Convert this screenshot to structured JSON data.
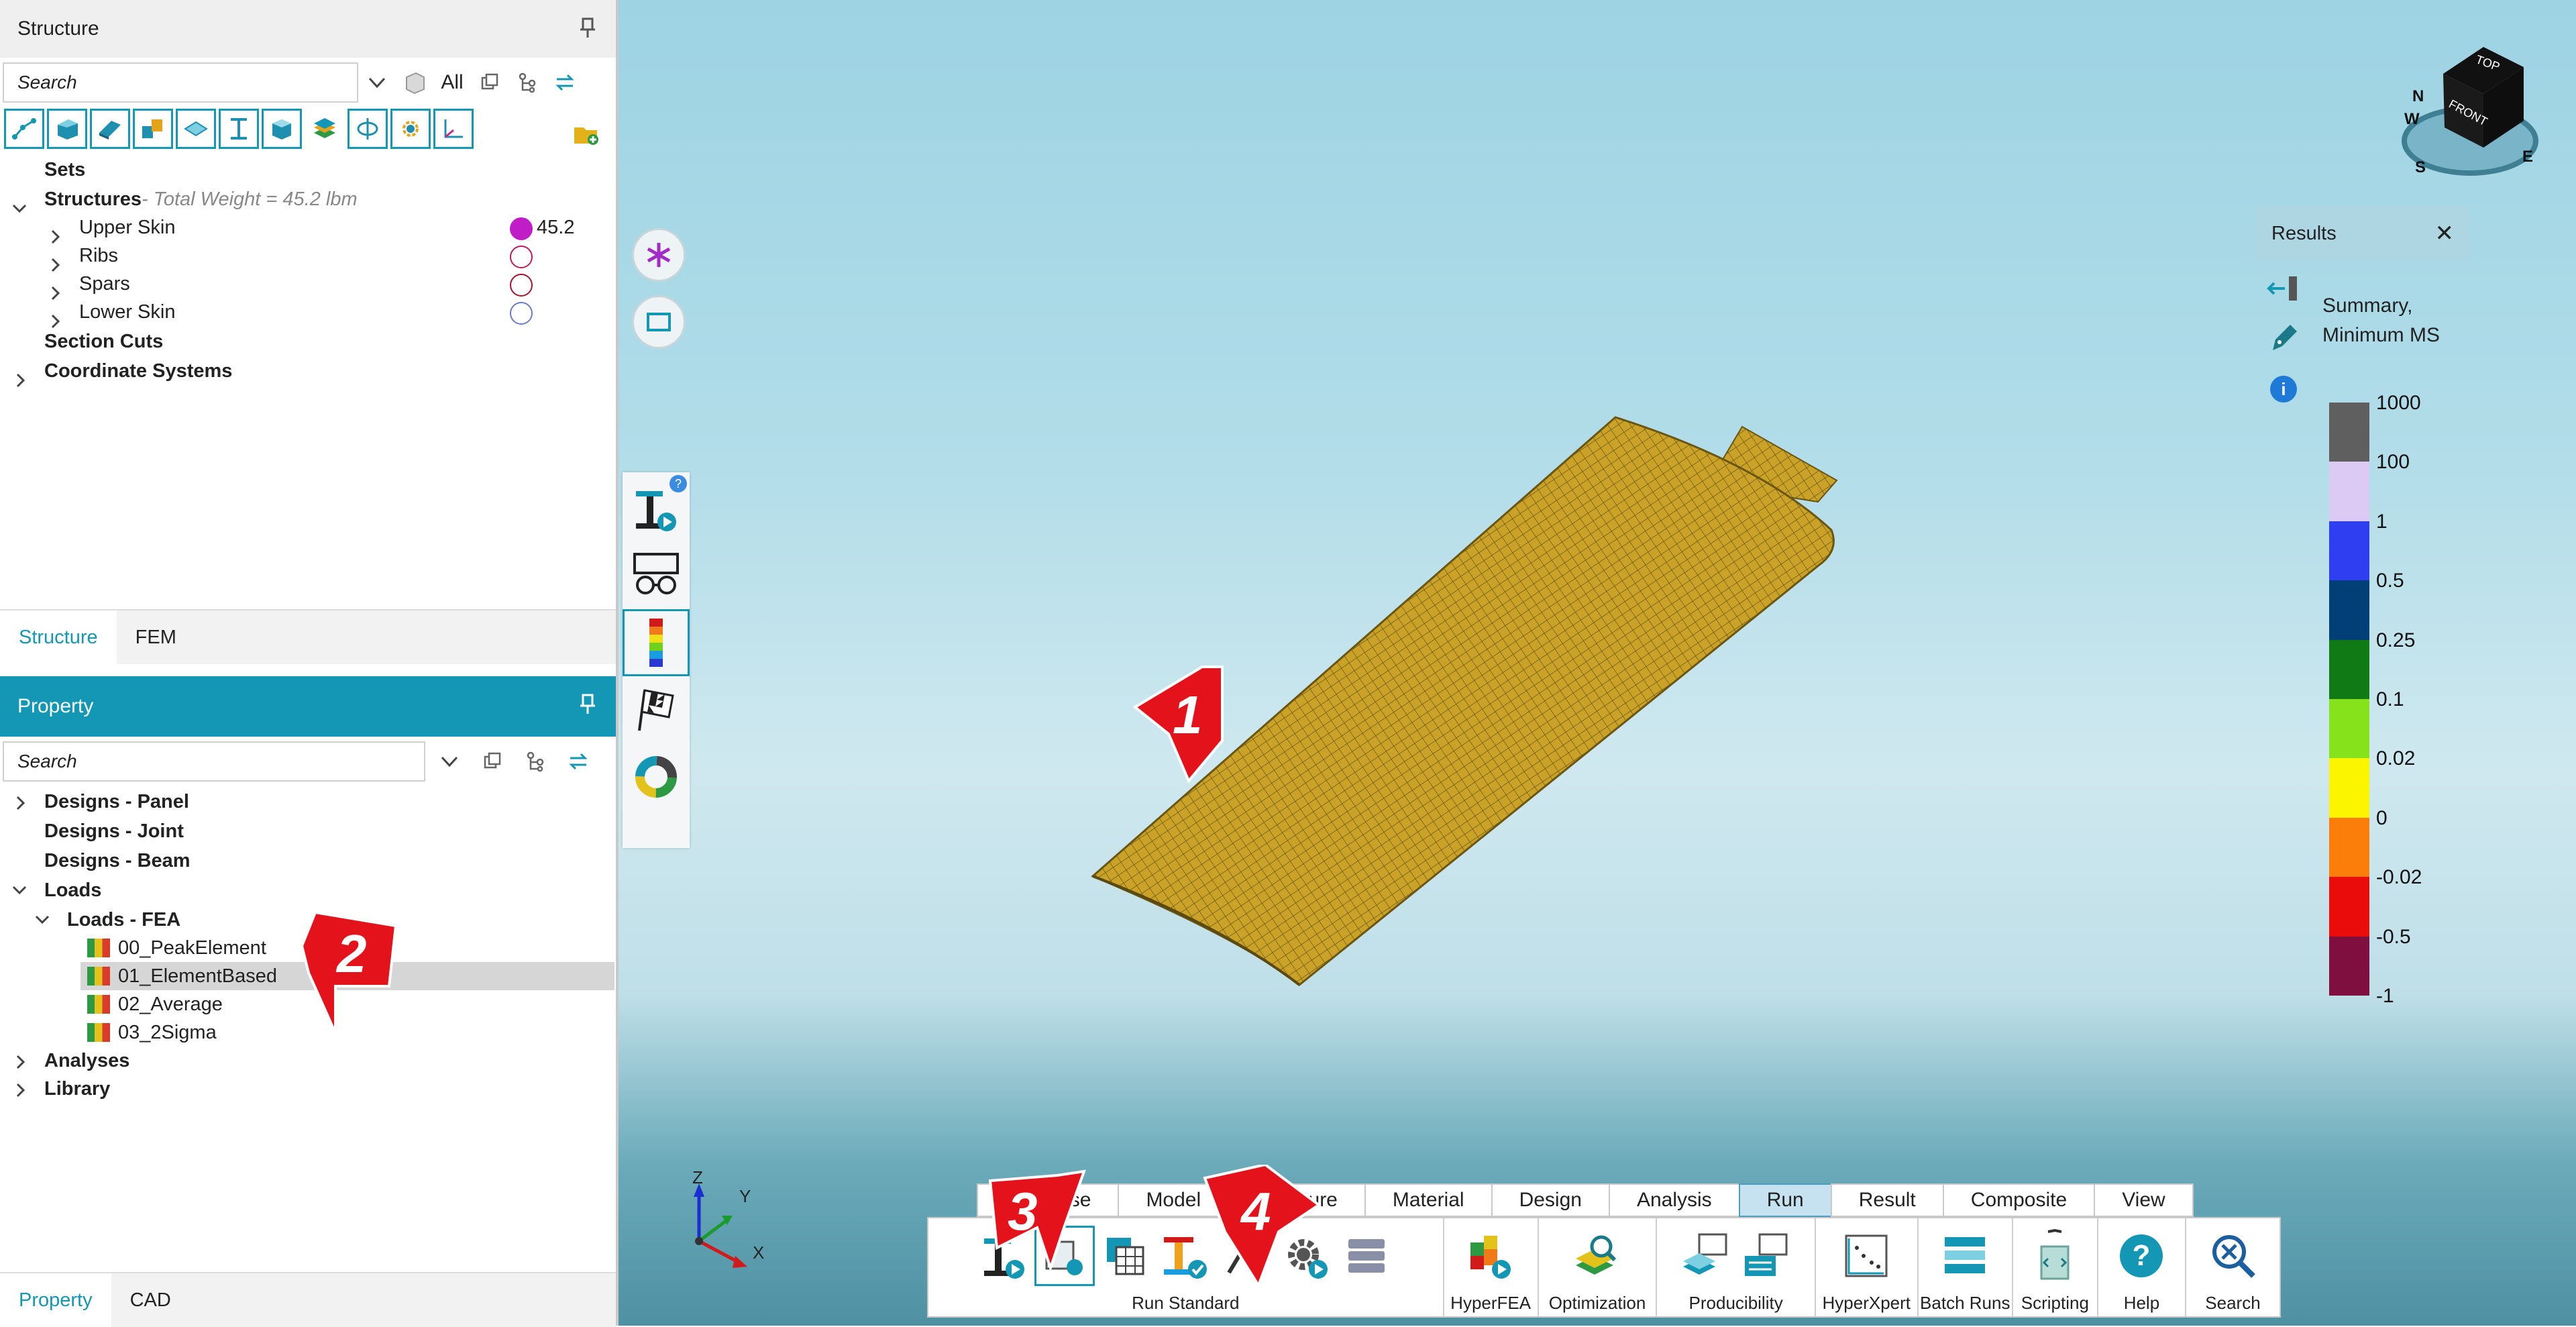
{
  "structure_panel": {
    "title": "Structure",
    "search_placeholder": "Search",
    "filter_label": "All",
    "tree": {
      "sets": "Sets",
      "structures": "Structures",
      "total_weight": " - Total Weight = 45.2 lbm",
      "upper_skin": "Upper Skin",
      "upper_skin_value": "45.2",
      "ribs": "Ribs",
      "spars": "Spars",
      "lower_skin": "Lower Skin",
      "section_cuts": "Section Cuts",
      "coordinate_systems": "Coordinate Systems"
    },
    "tabs": [
      "Structure",
      "FEM"
    ]
  },
  "property_panel": {
    "title": "Property",
    "search_placeholder": "Search",
    "tree": {
      "designs_panel": "Designs - Panel",
      "designs_joint": "Designs - Joint",
      "designs_beam": "Designs - Beam",
      "loads": "Loads",
      "loads_fea": "Loads - FEA",
      "items": [
        "00_PeakElement",
        "01_ElementBased",
        "02_Average",
        "03_2Sigma"
      ],
      "analyses": "Analyses",
      "library": "Library"
    },
    "tabs": [
      "Property",
      "CAD"
    ]
  },
  "viewcube": {
    "top": "TOP",
    "front": "FRONT",
    "n": "N",
    "w": "W",
    "s": "S",
    "e": "E"
  },
  "results": {
    "title": "Results",
    "subtitle": "Summary, Minimum MS",
    "legend": [
      {
        "label": "1000",
        "color": "#5f5f5f"
      },
      {
        "label": "100",
        "color": "#dccaf5"
      },
      {
        "label": "1",
        "color": "#2f3ef0"
      },
      {
        "label": "0.5",
        "color": "#023f77"
      },
      {
        "label": "0.25",
        "color": "#107a14"
      },
      {
        "label": "0.1",
        "color": "#86e21a"
      },
      {
        "label": "0.02",
        "color": "#fbf600"
      },
      {
        "label": "0",
        "color": "#fb7e0a"
      },
      {
        "label": "-0.02",
        "color": "#ea0b0b"
      },
      {
        "label": "-0.5",
        "color": "#7e0f3e"
      },
      {
        "label": "-1",
        "color": ""
      }
    ]
  },
  "triad": {
    "z": "Z",
    "y": "Y",
    "x": "X"
  },
  "ribbon": {
    "tabs": [
      "Database",
      "Model",
      "Structure",
      "Material",
      "Design",
      "Analysis",
      "Run",
      "Result",
      "Composite",
      "View"
    ],
    "active_tab": "Run",
    "groups": {
      "run_standard": "Run Standard",
      "hyperfea": "HyperFEA",
      "optimization": "Optimization",
      "producibility": "Producibility",
      "hyperxpert": "HyperXpert",
      "batch_runs": "Batch Runs",
      "scripting": "Scripting",
      "help": "Help",
      "search": "Search"
    }
  },
  "callouts": [
    "1",
    "2",
    "3",
    "4"
  ],
  "colors": {
    "accent": "#1397b5",
    "wing": "#c9a227",
    "callout": "#e3121b"
  }
}
